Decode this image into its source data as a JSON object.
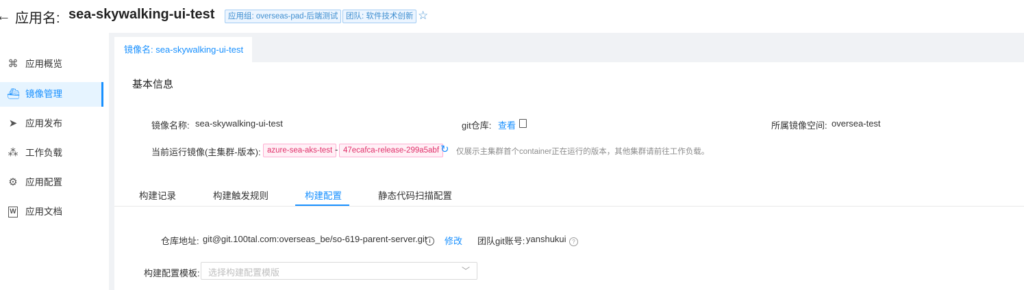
{
  "header": {
    "back_icon": "arrow-left-icon",
    "app_prefix": "应用名:",
    "app_name": "sea-skywalking-ui-test",
    "tag_group": "应用组: overseas-pad-后端测试",
    "tag_team": "团队: 软件技术创新",
    "star_icon": "star-outline-icon"
  },
  "sidebar": {
    "items": [
      {
        "label": "应用概览",
        "icon": "apps-icon"
      },
      {
        "label": "镜像管理",
        "icon": "docker-icon",
        "active": true
      },
      {
        "label": "应用发布",
        "icon": "send-icon"
      },
      {
        "label": "工作负载",
        "icon": "cluster-icon"
      },
      {
        "label": "应用配置",
        "icon": "settings-icon"
      },
      {
        "label": "应用文档",
        "icon": "word-doc-icon"
      }
    ]
  },
  "image_tab": "镜像名: sea-skywalking-ui-test",
  "basic_info": {
    "title": "基本信息",
    "image_name_label": "镜像名称:",
    "image_name_value": "sea-skywalking-ui-test",
    "git_label": "git仓库:",
    "git_view": "查看",
    "namespace_label": "所属镜像空间:",
    "namespace_value": "oversea-test",
    "running_label": "当前运行镜像(主集群-版本):",
    "cluster": "azure-sea-aks-test",
    "dash": "-",
    "version": "47ecafca-release-299a5abf",
    "hint": "仅展示主集群首个container正在运行的版本，其他集群请前往工作负载。"
  },
  "sub_tabs": [
    "构建记录",
    "构建触发规则",
    "构建配置",
    "静态代码扫描配置"
  ],
  "active_sub_tab": "构建配置",
  "build_config": {
    "repo_label": "仓库地址:",
    "repo_value": "git@git.100tal.com:overseas_be/so-619-parent-server.git",
    "edit": "修改",
    "team_git_label": "团队git账号:",
    "team_git_value": "yanshukui",
    "template_label": "构建配置模板:",
    "template_placeholder": "选择构建配置模版"
  }
}
